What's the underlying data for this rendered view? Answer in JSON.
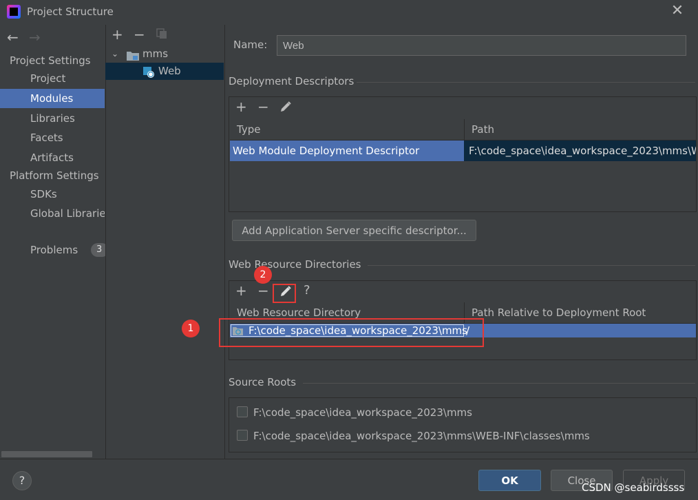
{
  "window": {
    "title": "Project Structure",
    "close_icon": "close-icon"
  },
  "nav": {
    "back_icon": "←",
    "forward_icon": "→",
    "project_settings_header": "Project Settings",
    "project_settings_items": [
      {
        "label": "Project",
        "selected": false
      },
      {
        "label": "Modules",
        "selected": true
      },
      {
        "label": "Libraries",
        "selected": false
      },
      {
        "label": "Facets",
        "selected": false
      },
      {
        "label": "Artifacts",
        "selected": false
      }
    ],
    "platform_settings_header": "Platform Settings",
    "platform_settings_items": [
      {
        "label": "SDKs"
      },
      {
        "label": "Global Libraries"
      }
    ],
    "problems_label": "Problems",
    "problems_badge": "3"
  },
  "tree": {
    "toolbar": {
      "add": "+",
      "remove": "−",
      "copy_icon": "copy-icon"
    },
    "root": {
      "label": "mms",
      "expanded": true
    },
    "child": {
      "label": "Web",
      "selected": true
    }
  },
  "facet": {
    "name_label": "Name:",
    "name_value": "Web",
    "deployment_descriptors": {
      "title": "Deployment Descriptors",
      "columns": [
        "Type",
        "Path"
      ],
      "rows": [
        {
          "type": "Web Module Deployment Descriptor",
          "path": "F:\\code_space\\idea_workspace_2023\\mms\\W"
        }
      ],
      "add_server_button": "Add Application Server specific descriptor..."
    },
    "web_resource_dirs": {
      "title": "Web Resource Directories",
      "columns": [
        "Web Resource Directory",
        "Path Relative to Deployment Root"
      ],
      "rows": [
        {
          "directory": "F:\\code_space\\idea_workspace_2023\\mms",
          "relative": "/"
        }
      ],
      "help": "?"
    },
    "source_roots": {
      "title": "Source Roots",
      "items": [
        {
          "path": "F:\\code_space\\idea_workspace_2023\\mms",
          "checked": false
        },
        {
          "path": "F:\\code_space\\idea_workspace_2023\\mms\\WEB-INF\\classes\\mms",
          "checked": false
        }
      ]
    }
  },
  "annotations": {
    "marker_1": "1",
    "marker_2": "2"
  },
  "footer": {
    "help": "?",
    "ok": "OK",
    "close": "Close",
    "apply": "Apply",
    "watermark": "CSDN @seabirdssss"
  },
  "colors": {
    "selection": "#4b6eaf",
    "annotation": "#e53935",
    "background": "#3c3f41"
  }
}
